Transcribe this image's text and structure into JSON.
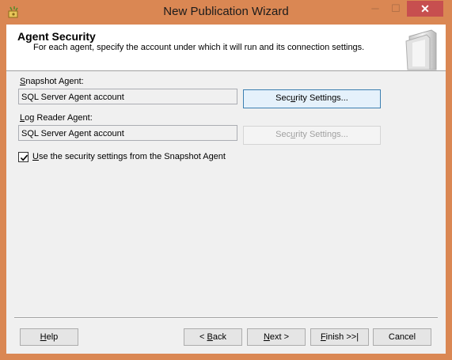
{
  "window": {
    "title": "New Publication Wizard",
    "minimize_glyph": "─",
    "maximize_glyph": "☐",
    "close_glyph": "✕"
  },
  "header": {
    "title": "Agent Security",
    "description": "For each agent, specify the account under which it will run and its connection settings."
  },
  "snapshot_agent": {
    "label_key": "S",
    "label_rest": "napshot Agent:",
    "account": "SQL Server Agent account",
    "button_pre": "Sec",
    "button_key": "u",
    "button_post": "rity Settings..."
  },
  "log_reader_agent": {
    "label_key": "L",
    "label_rest": "og Reader Agent:",
    "account": "SQL Server Agent account",
    "button_pre": "Sec",
    "button_key": "u",
    "button_post": "rity Settings..."
  },
  "checkbox": {
    "checked": true,
    "label_key": "U",
    "label_rest": "se the security settings from the Snapshot Agent"
  },
  "footer": {
    "help_key": "H",
    "help_rest": "elp",
    "back_pre": "< ",
    "back_key": "B",
    "back_rest": "ack",
    "next_key": "N",
    "next_rest": "ext >",
    "finish_key": "F",
    "finish_rest": "inish >>|",
    "cancel": "Cancel"
  },
  "icons": {
    "app": "wizard-app-icon",
    "header_graphic": "wizard-pages-graphic",
    "check": "checkmark-icon"
  },
  "colors": {
    "frame": "#DA8753",
    "close": "#C74F4F",
    "focus_border": "#3C7FB1"
  }
}
